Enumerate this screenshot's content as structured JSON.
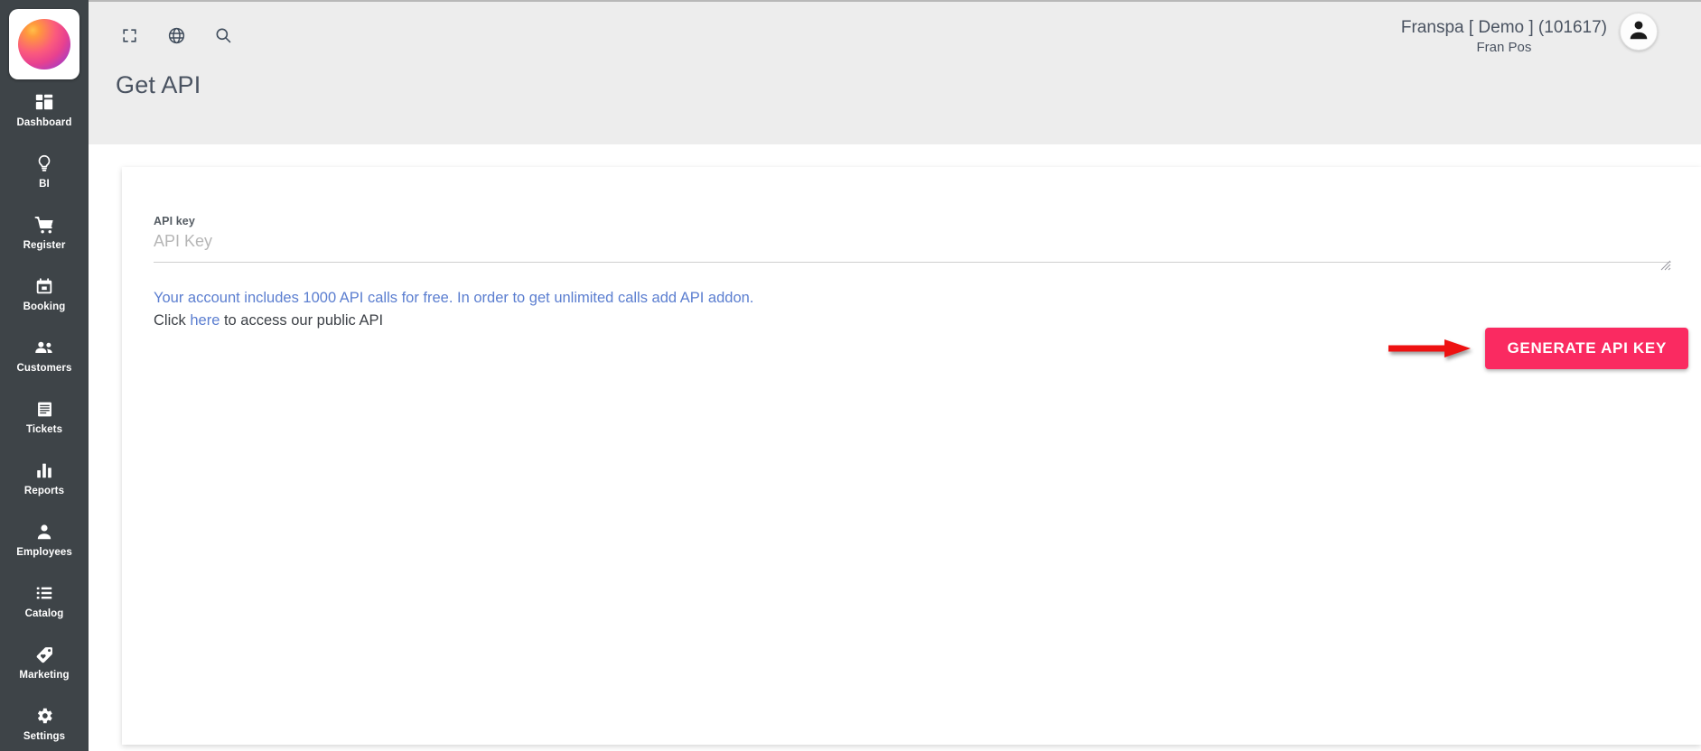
{
  "app": {
    "logo_name": "gradient-circle-logo",
    "sidebar_bg": "#3E4448",
    "page_bg": "#EDEDED",
    "accent_pink": "#FA2A61",
    "link_blue": "#5B7ED0",
    "annotation_red": "#EE1111"
  },
  "sidebar": {
    "items": [
      {
        "label": "Dashboard",
        "icon": "dashboard-grid-icon"
      },
      {
        "label": "BI",
        "icon": "lightbulb-icon"
      },
      {
        "label": "Register",
        "icon": "shopping-cart-icon"
      },
      {
        "label": "Booking",
        "icon": "calendar-icon"
      },
      {
        "label": "Customers",
        "icon": "people-group-icon"
      },
      {
        "label": "Tickets",
        "icon": "ticket-list-icon"
      },
      {
        "label": "Reports",
        "icon": "bar-chart-icon"
      },
      {
        "label": "Employees",
        "icon": "person-icon"
      },
      {
        "label": "Catalog",
        "icon": "list-bullets-icon"
      },
      {
        "label": "Marketing",
        "icon": "price-tag-heart-icon"
      },
      {
        "label": "Settings",
        "icon": "gear-icon"
      }
    ]
  },
  "topbar": {
    "icons": [
      {
        "name": "fullscreen-icon"
      },
      {
        "name": "globe-icon"
      },
      {
        "name": "search-icon"
      }
    ],
    "page_title": "Get API",
    "user_name": "Franspa [ Demo ] (101617)",
    "user_role": "Fran Pos",
    "avatar_name": "user-avatar-icon"
  },
  "main": {
    "field": {
      "label": "API key",
      "placeholder": "API Key",
      "value": ""
    },
    "info": {
      "line1": "Your account includes 1000 API calls for free. In order to get unlimited calls add API addon.",
      "line2_prefix": "Click ",
      "line2_link": "here",
      "line2_suffix": " to access our public API"
    },
    "generate_button_label": "GENERATE API KEY",
    "annotation": "red-arrow-pointing-right"
  }
}
